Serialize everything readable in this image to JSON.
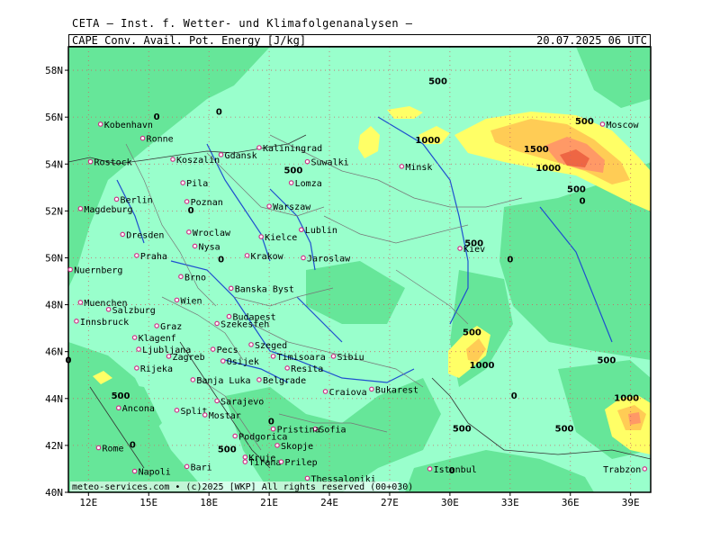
{
  "header": {
    "institute": "CETA — Inst. f. Wetter- und Klimafolgenanalysen —",
    "parameter": "CAPE Conv. Avail. Pot. Energy [J/kg]",
    "valid_time": "20.07.2025 06 UTC"
  },
  "footer": "meteo-services.com • (c)2025 [WKP] All rights reserved (00+030)",
  "colors": {
    "background_low": "#99ffcc",
    "level_0": "#66e699",
    "level_500": "#ffff66",
    "level_1000": "#ffcc55",
    "level_1500": "#ff9966",
    "level_2000": "#ee6644",
    "rivers": "#1f4fcf",
    "borders": "#777777",
    "grid": "#cc6666",
    "city_marker": "#cc3388"
  },
  "map": {
    "lat_labels": [
      "58N",
      "56N",
      "54N",
      "52N",
      "50N",
      "48N",
      "46N",
      "44N",
      "42N",
      "40N"
    ],
    "lon_labels": [
      "12E",
      "15E",
      "18E",
      "21E",
      "24E",
      "27E",
      "30E",
      "33E",
      "36E",
      "39E"
    ],
    "cities": [
      {
        "name": "Kobenhavn",
        "lon": 12.6,
        "lat": 55.7
      },
      {
        "name": "Ronne",
        "lon": 14.7,
        "lat": 55.1
      },
      {
        "name": "Rostock",
        "lon": 12.1,
        "lat": 54.1
      },
      {
        "name": "Koszalin",
        "lon": 16.2,
        "lat": 54.2
      },
      {
        "name": "Gdansk",
        "lon": 18.6,
        "lat": 54.4
      },
      {
        "name": "Kaliningrad",
        "lon": 20.5,
        "lat": 54.7
      },
      {
        "name": "Suwalki",
        "lon": 22.9,
        "lat": 54.1
      },
      {
        "name": "Minsk",
        "lon": 27.6,
        "lat": 53.9
      },
      {
        "name": "Moscow",
        "lon": 37.6,
        "lat": 55.7
      },
      {
        "name": "Pila",
        "lon": 16.7,
        "lat": 53.2
      },
      {
        "name": "Lomza",
        "lon": 22.1,
        "lat": 53.2
      },
      {
        "name": "Berlin",
        "lon": 13.4,
        "lat": 52.5
      },
      {
        "name": "Poznan",
        "lon": 16.9,
        "lat": 52.4
      },
      {
        "name": "Warszaw",
        "lon": 21.0,
        "lat": 52.2
      },
      {
        "name": "Magdeburg",
        "lon": 11.6,
        "lat": 52.1
      },
      {
        "name": "Lublin",
        "lon": 22.6,
        "lat": 51.2
      },
      {
        "name": "Dresden",
        "lon": 13.7,
        "lat": 51.0
      },
      {
        "name": "Wroclaw",
        "lon": 17.0,
        "lat": 51.1
      },
      {
        "name": "Kielce",
        "lon": 20.6,
        "lat": 50.9
      },
      {
        "name": "Kiev",
        "lon": 30.5,
        "lat": 50.4
      },
      {
        "name": "Nysa",
        "lon": 17.3,
        "lat": 50.5
      },
      {
        "name": "Praha",
        "lon": 14.4,
        "lat": 50.1
      },
      {
        "name": "Krakow",
        "lon": 19.9,
        "lat": 50.1
      },
      {
        "name": "Jaroslaw",
        "lon": 22.7,
        "lat": 50.0
      },
      {
        "name": "Nuernberg",
        "lon": 11.1,
        "lat": 49.5
      },
      {
        "name": "Brno",
        "lon": 16.6,
        "lat": 49.2
      },
      {
        "name": "Banska Byst",
        "lon": 19.1,
        "lat": 48.7
      },
      {
        "name": "Muenchen",
        "lon": 11.6,
        "lat": 48.1
      },
      {
        "name": "Wien",
        "lon": 16.4,
        "lat": 48.2
      },
      {
        "name": "Salzburg",
        "lon": 13.0,
        "lat": 47.8
      },
      {
        "name": "Budapest",
        "lon": 19.0,
        "lat": 47.5
      },
      {
        "name": "Innsbruck",
        "lon": 11.4,
        "lat": 47.3
      },
      {
        "name": "Szekesfeh",
        "lon": 18.4,
        "lat": 47.2
      },
      {
        "name": "Graz",
        "lon": 15.4,
        "lat": 47.1
      },
      {
        "name": "Szeged",
        "lon": 20.1,
        "lat": 46.3
      },
      {
        "name": "Klagenf",
        "lon": 14.3,
        "lat": 46.6
      },
      {
        "name": "Ljubljana",
        "lon": 14.5,
        "lat": 46.1
      },
      {
        "name": "Pecs",
        "lon": 18.2,
        "lat": 46.1
      },
      {
        "name": "Sibiu",
        "lon": 24.2,
        "lat": 45.8
      },
      {
        "name": "Timisoara",
        "lon": 21.2,
        "lat": 45.8
      },
      {
        "name": "Zagreb",
        "lon": 16.0,
        "lat": 45.8
      },
      {
        "name": "Rijeka",
        "lon": 14.4,
        "lat": 45.3
      },
      {
        "name": "Osijek",
        "lon": 18.7,
        "lat": 45.6
      },
      {
        "name": "Resita",
        "lon": 21.9,
        "lat": 45.3
      },
      {
        "name": "Banja Luka",
        "lon": 17.2,
        "lat": 44.8
      },
      {
        "name": "Belgrade",
        "lon": 20.5,
        "lat": 44.8
      },
      {
        "name": "Bukarest",
        "lon": 26.1,
        "lat": 44.4
      },
      {
        "name": "Craiova",
        "lon": 23.8,
        "lat": 44.3
      },
      {
        "name": "Sarajevo",
        "lon": 18.4,
        "lat": 43.9
      },
      {
        "name": "Split",
        "lon": 16.4,
        "lat": 43.5
      },
      {
        "name": "Ancona",
        "lon": 13.5,
        "lat": 43.6
      },
      {
        "name": "Mostar",
        "lon": 17.8,
        "lat": 43.3
      },
      {
        "name": "Sofia",
        "lon": 23.3,
        "lat": 42.7
      },
      {
        "name": "Pristina",
        "lon": 21.2,
        "lat": 42.7
      },
      {
        "name": "Podgorica",
        "lon": 19.3,
        "lat": 42.4
      },
      {
        "name": "Skopje",
        "lon": 21.4,
        "lat": 42.0
      },
      {
        "name": "Kruje",
        "lon": 19.8,
        "lat": 41.5
      },
      {
        "name": "Tirana",
        "lon": 19.8,
        "lat": 41.3
      },
      {
        "name": "Rome",
        "lon": 12.5,
        "lat": 41.9
      },
      {
        "name": "Prilep",
        "lon": 21.6,
        "lat": 41.3
      },
      {
        "name": "Istanbul",
        "lon": 29.0,
        "lat": 41.0
      },
      {
        "name": "Napoli",
        "lon": 14.3,
        "lat": 40.9
      },
      {
        "name": "Bari",
        "lon": 16.9,
        "lat": 41.1
      },
      {
        "name": "Thessaloniki",
        "lon": 22.9,
        "lat": 40.6
      },
      {
        "name": "Trabzon",
        "lon": 39.7,
        "lat": 41.0
      }
    ],
    "isoline_labels": [
      {
        "text": "500",
        "lon": 29.4,
        "lat": 57.4
      },
      {
        "text": "0",
        "lon": 18.5,
        "lat": 56.1
      },
      {
        "text": "0",
        "lon": 15.4,
        "lat": 55.9
      },
      {
        "text": "1000",
        "lon": 28.9,
        "lat": 54.9
      },
      {
        "text": "500",
        "lon": 36.7,
        "lat": 55.7
      },
      {
        "text": "1500",
        "lon": 34.3,
        "lat": 54.5
      },
      {
        "text": "1000",
        "lon": 34.9,
        "lat": 53.7
      },
      {
        "text": "500",
        "lon": 36.3,
        "lat": 52.8
      },
      {
        "text": "0",
        "lon": 36.6,
        "lat": 52.3
      },
      {
        "text": "500",
        "lon": 22.2,
        "lat": 53.6
      },
      {
        "text": "0",
        "lon": 17.1,
        "lat": 51.9
      },
      {
        "text": "500",
        "lon": 31.2,
        "lat": 50.5
      },
      {
        "text": "0",
        "lon": 18.6,
        "lat": 49.8
      },
      {
        "text": "0",
        "lon": 33.0,
        "lat": 49.8
      },
      {
        "text": "500",
        "lon": 31.1,
        "lat": 46.7
      },
      {
        "text": "0",
        "lon": 11.0,
        "lat": 45.5
      },
      {
        "text": "1000",
        "lon": 31.6,
        "lat": 45.3
      },
      {
        "text": "500",
        "lon": 37.8,
        "lat": 45.5
      },
      {
        "text": "500",
        "lon": 13.6,
        "lat": 44.0
      },
      {
        "text": "0",
        "lon": 33.2,
        "lat": 44.0
      },
      {
        "text": "1000",
        "lon": 38.8,
        "lat": 43.9
      },
      {
        "text": "0",
        "lon": 21.1,
        "lat": 42.9
      },
      {
        "text": "500",
        "lon": 30.6,
        "lat": 42.6
      },
      {
        "text": "500",
        "lon": 35.7,
        "lat": 42.6
      },
      {
        "text": "0",
        "lon": 14.2,
        "lat": 41.9
      },
      {
        "text": "500",
        "lon": 18.9,
        "lat": 41.7
      },
      {
        "text": "0",
        "lon": 30.1,
        "lat": 40.8
      }
    ]
  }
}
